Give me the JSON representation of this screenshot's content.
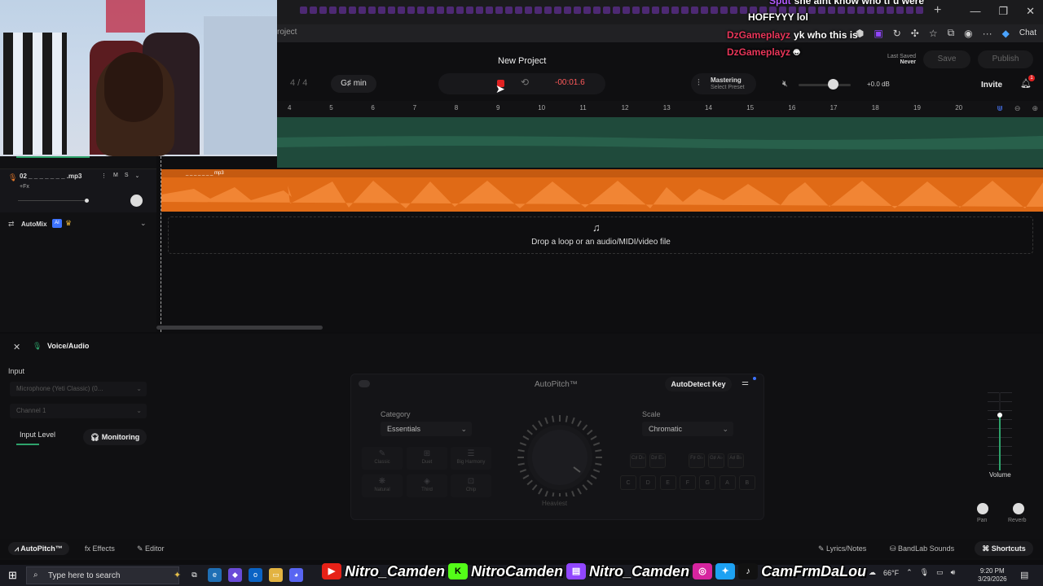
{
  "browser": {
    "address_text": "roject",
    "new_tab": "+",
    "window_controls": [
      "—",
      "❐",
      "✕"
    ],
    "chat_label": "Chat"
  },
  "chat_overlay": [
    {
      "name": "Sput",
      "message": "she aint know who tf u were"
    },
    {
      "name": "",
      "message": "HOFFYYY lol"
    },
    {
      "name": "DzGameplayz",
      "message": "yk who this is"
    },
    {
      "name": "DzGameplayz",
      "message": ""
    }
  ],
  "header": {
    "project_title": "New Project",
    "time_signature": "4 / 4",
    "key": "G♯ min",
    "timecode": "-00:01.6",
    "mastering_title": "Mastering",
    "mastering_sub": "Select Preset",
    "db_readout": "+0.0 dB",
    "last_saved_label": "Last Saved",
    "last_saved_value": "Never",
    "save_label": "Save",
    "publish_label": "Publish",
    "invite_label": "Invite",
    "notif_count": "1"
  },
  "ruler": {
    "ticks": [
      "4",
      "5",
      "6",
      "7",
      "8",
      "9",
      "10",
      "11",
      "12",
      "13",
      "14",
      "15",
      "16",
      "17",
      "18",
      "19",
      "20"
    ]
  },
  "tracks": {
    "track2_name": "02 _ _ _ _ _ _ _ .mp3",
    "clip_label": "_ _ _ _ _ _ _ mp3",
    "fx_label": "+Fx",
    "mute": "M",
    "solo": "S",
    "automix_label": "AutoMix",
    "ai_badge": "AI"
  },
  "dropzone": {
    "text": "Drop a loop or an audio/MIDI/video file"
  },
  "panel": {
    "title": "Voice/Audio",
    "input_label": "Input",
    "input_device": "Microphone (Yeti Classic) (0...",
    "channel": "Channel 1",
    "input_level_label": "Input Level",
    "monitoring_label": "Monitoring"
  },
  "autopitch": {
    "title": "AutoPitch™",
    "autodetect_label": "AutoDetect Key",
    "category_label": "Category",
    "category_value": "Essentials",
    "scale_label": "Scale",
    "scale_value": "Chromatic",
    "presets": [
      "Classic",
      "Duet",
      "Big Harmony",
      "Natural",
      "Third",
      "Chip"
    ],
    "knob_label": "Heaviest",
    "sharp_notes": [
      {
        "top": "C♯",
        "bottom": "D♭"
      },
      {
        "top": "D♯",
        "bottom": "E♭"
      },
      {
        "top": "F♯",
        "bottom": "G♭"
      },
      {
        "top": "G♯",
        "bottom": "A♭"
      },
      {
        "top": "A♯",
        "bottom": "B♭"
      }
    ],
    "white_notes": [
      "C",
      "D",
      "E",
      "F",
      "G",
      "A",
      "B"
    ]
  },
  "mixer": {
    "volume_label": "Volume",
    "pan_label": "Pan",
    "reverb_label": "Reverb"
  },
  "bottom_tabs": {
    "autopitch": "AutoPitch™",
    "effects": "Effects",
    "editor": "Editor",
    "lyrics": "Lyrics/Notes",
    "sounds": "BandLab Sounds",
    "shortcuts": "Shortcuts"
  },
  "taskbar": {
    "search_placeholder": "Type here to search",
    "weather": "66°F",
    "time": "9:20 PM",
    "date": "3/29/2026"
  },
  "socials": {
    "youtube": "Nitro_Camden",
    "kick": "NitroCamden",
    "twitch": "Nitro_Camden",
    "handle": "CamFrmDaLou"
  }
}
